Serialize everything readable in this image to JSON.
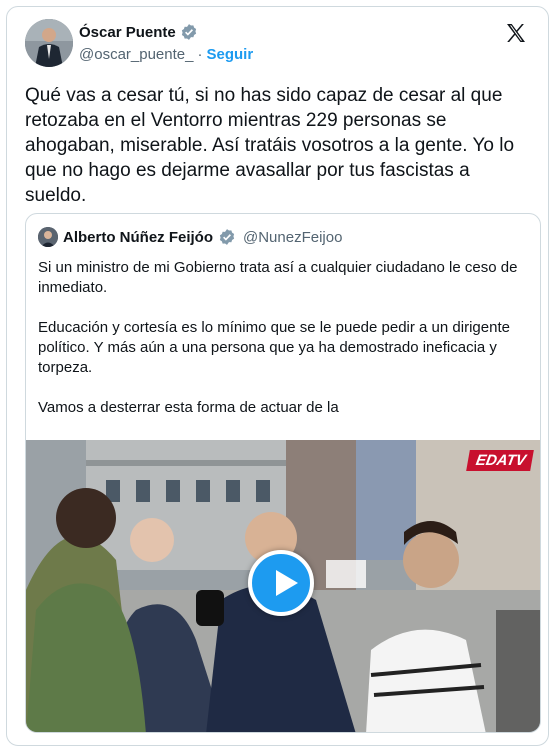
{
  "author": {
    "name": "Óscar Puente",
    "handle": "@oscar_puente_",
    "separator": "·",
    "follow_label": "Seguir"
  },
  "tweet": {
    "text": "Qué vas a cesar tú, si no has sido capaz de cesar al que retozaba en el Ventorro mientras 229 personas se ahogaban, miserable. Así tratáis vosotros a la gente. Yo lo que no hago es dejarme avasallar por tus fascistas a sueldo."
  },
  "quoted": {
    "name": "Alberto Núñez Feijóo",
    "handle": "@NunezFeijoo",
    "text": "Si un ministro de mi Gobierno trata así a cualquier ciudadano le ceso de inmediato.\n\nEducación y cortesía es lo mínimo que se le puede pedir a un dirigente político. Y más aún a una persona que ya ha demostrado ineficacia y torpeza.\n\nVamos a desterrar esta forma de actuar de la",
    "video_watermark": "EDATV"
  },
  "colors": {
    "link": "#1d9bf0",
    "verified": "#829aab",
    "secondary_text": "#536471",
    "border": "#cfd9de"
  },
  "icons": {
    "verified": "verified-badge-icon",
    "platform": "x-logo-icon",
    "play": "play-icon"
  }
}
